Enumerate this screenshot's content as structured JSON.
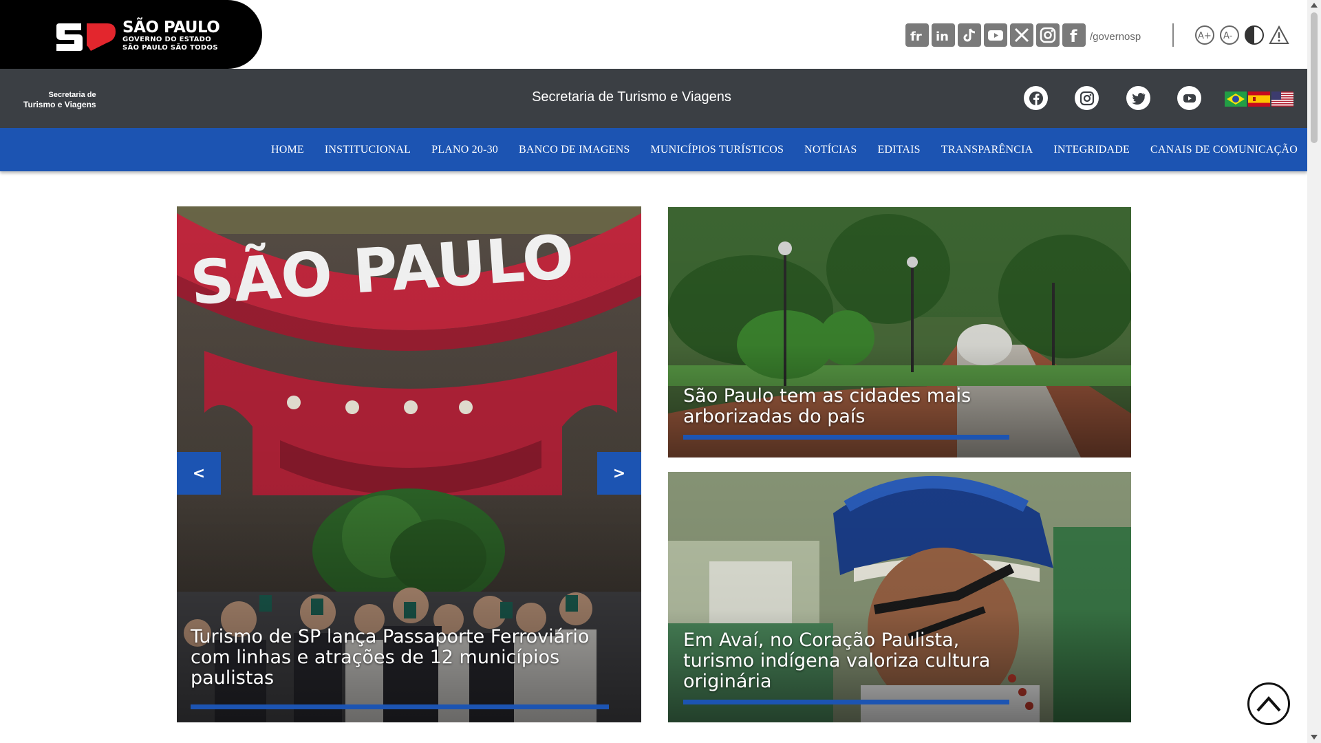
{
  "gov_header": {
    "logo_line1": "SÃO PAULO",
    "logo_line2": "GOVERNO DO ESTADO",
    "logo_line3": "SÃO PAULO SÃO TODOS",
    "social_icons": [
      "flickr-icon",
      "linkedin-icon",
      "tiktok-icon",
      "youtube-icon",
      "x-icon",
      "instagram-icon",
      "facebook-icon"
    ],
    "handle": "/governosp",
    "accessibility_icons": [
      "increase-font-icon",
      "decrease-font-icon",
      "contrast-icon",
      "alert-icon"
    ]
  },
  "secretaria": {
    "logo_line1": "Secretaria de",
    "logo_line2": "Turismo e Viagens",
    "title": "Secretaria de Turismo e Viagens",
    "social_icons": [
      "facebook-icon",
      "instagram-icon",
      "twitter-icon",
      "youtube-icon"
    ],
    "languages": [
      "Português",
      "Español",
      "English"
    ]
  },
  "nav": {
    "items": [
      "HOME",
      "INSTITUCIONAL",
      "PLANO 20-30",
      "BANCO DE IMAGENS",
      "MUNICÍPIOS TURÍSTICOS",
      "NOTÍCIAS",
      "EDITAIS",
      "TRANSPARÊNCIA",
      "INTEGRIDADE",
      "CANAIS DE COMUNICAÇÃO"
    ]
  },
  "carousel": {
    "prev_label": "<",
    "next_label": ">",
    "main_caption": "Turismo de SP lança Passaporte Ferroviário com linhas e atrações de 12 municípios paulistas"
  },
  "news": [
    {
      "caption": "São Paulo tem as cidades mais arborizadas do país"
    },
    {
      "caption": "Em Avaí, no Coração Paulista, turismo indígena valoriza cultura originária"
    }
  ],
  "colors": {
    "nav_blue": "#1c54b2",
    "dark_bar": "#3b3f44",
    "brand_red": "#e3262d"
  }
}
